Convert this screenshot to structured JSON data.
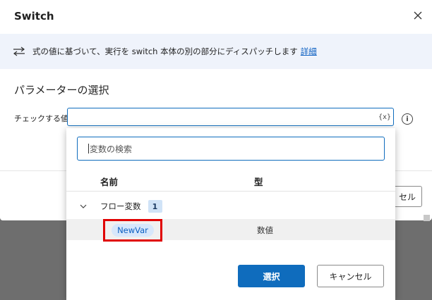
{
  "dialog": {
    "title": "Switch",
    "info_text": "式の値に基づいて、実行を switch 本体の別の部分にディスパッチします",
    "info_link": "詳細",
    "section_title": "パラメーターの選択",
    "param_label": "チェックする値:",
    "param_value": "",
    "var_button": "{x}",
    "info_icon": "i",
    "cancel_partial": "セル"
  },
  "popup": {
    "search_placeholder": "変数の検索",
    "columns": {
      "name": "名前",
      "type": "型"
    },
    "group": {
      "label": "フロー変数",
      "count": "1"
    },
    "rows": [
      {
        "name": "NewVar",
        "type": "数値"
      }
    ],
    "select_button": "選択",
    "cancel_button": "キャンセル"
  },
  "colors": {
    "accent": "#0f6cbd",
    "highlight": "#e00000",
    "chip_bg": "#d7e7fb"
  },
  "icons": [
    "close-icon",
    "swap-arrows-icon",
    "variable-icon",
    "info-icon",
    "chevron-down-icon"
  ]
}
